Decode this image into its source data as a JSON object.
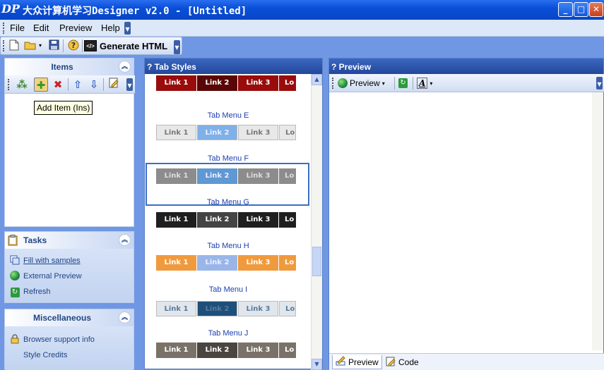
{
  "window": {
    "title": "大众计算机学习Designer v2.0 - [Untitled]",
    "logo": "DP",
    "minimize": "_",
    "maximize": "□",
    "close": "✕"
  },
  "menu": {
    "items": [
      {
        "label": "File",
        "accel": "F"
      },
      {
        "label": "Edit",
        "accel": "E"
      },
      {
        "label": "Preview",
        "accel": "P"
      },
      {
        "label": "Help",
        "accel": "H"
      }
    ]
  },
  "toolbar": {
    "generate_label": "Generate HTML",
    "generate_icon_text": "</>"
  },
  "items_panel": {
    "title": "Items",
    "tooltip": "Add Item (Ins)"
  },
  "tasks_panel": {
    "title": "Tasks",
    "items": [
      {
        "label": "Fill with samples",
        "icon": "samples-icon"
      },
      {
        "label": "External Preview",
        "icon": "globe-icon"
      },
      {
        "label": "Refresh",
        "icon": "refresh-icon"
      }
    ]
  },
  "misc_panel": {
    "title": "Miscellaneous",
    "items": [
      {
        "label": "Browser support info",
        "icon": "lock-icon"
      },
      {
        "label": "Style Credits"
      }
    ]
  },
  "tab_styles": {
    "title": "? Tab Styles",
    "link_labels": [
      "Link 1",
      "Link 2",
      "Link 3",
      "Lo"
    ],
    "captions": [
      "Tab Menu E",
      "Tab Menu F",
      "Tab Menu G",
      "Tab Menu H",
      "Tab Menu I",
      "Tab Menu J"
    ],
    "colors": {
      "red": "#9a0c0c",
      "red_active": "#5a0606",
      "silver": "#e8e8e8",
      "silver_active": "#7fb0e8",
      "gray": "#8c8c8c",
      "gray_active": "#5f98d3",
      "black": "#1f1f1f",
      "black_active": "#444444",
      "orange": "#f09a3e",
      "orange_active": "#9ab6e8",
      "light": "#e0e6ec",
      "light_active": "#1d4f7a",
      "taupe": "#7a7268",
      "taupe_active": "#4a4540"
    }
  },
  "preview_panel": {
    "title": "? Preview",
    "preview_button": "Preview",
    "font_icon": "A",
    "tabs": [
      {
        "label": "Preview"
      },
      {
        "label": "Code"
      }
    ]
  }
}
